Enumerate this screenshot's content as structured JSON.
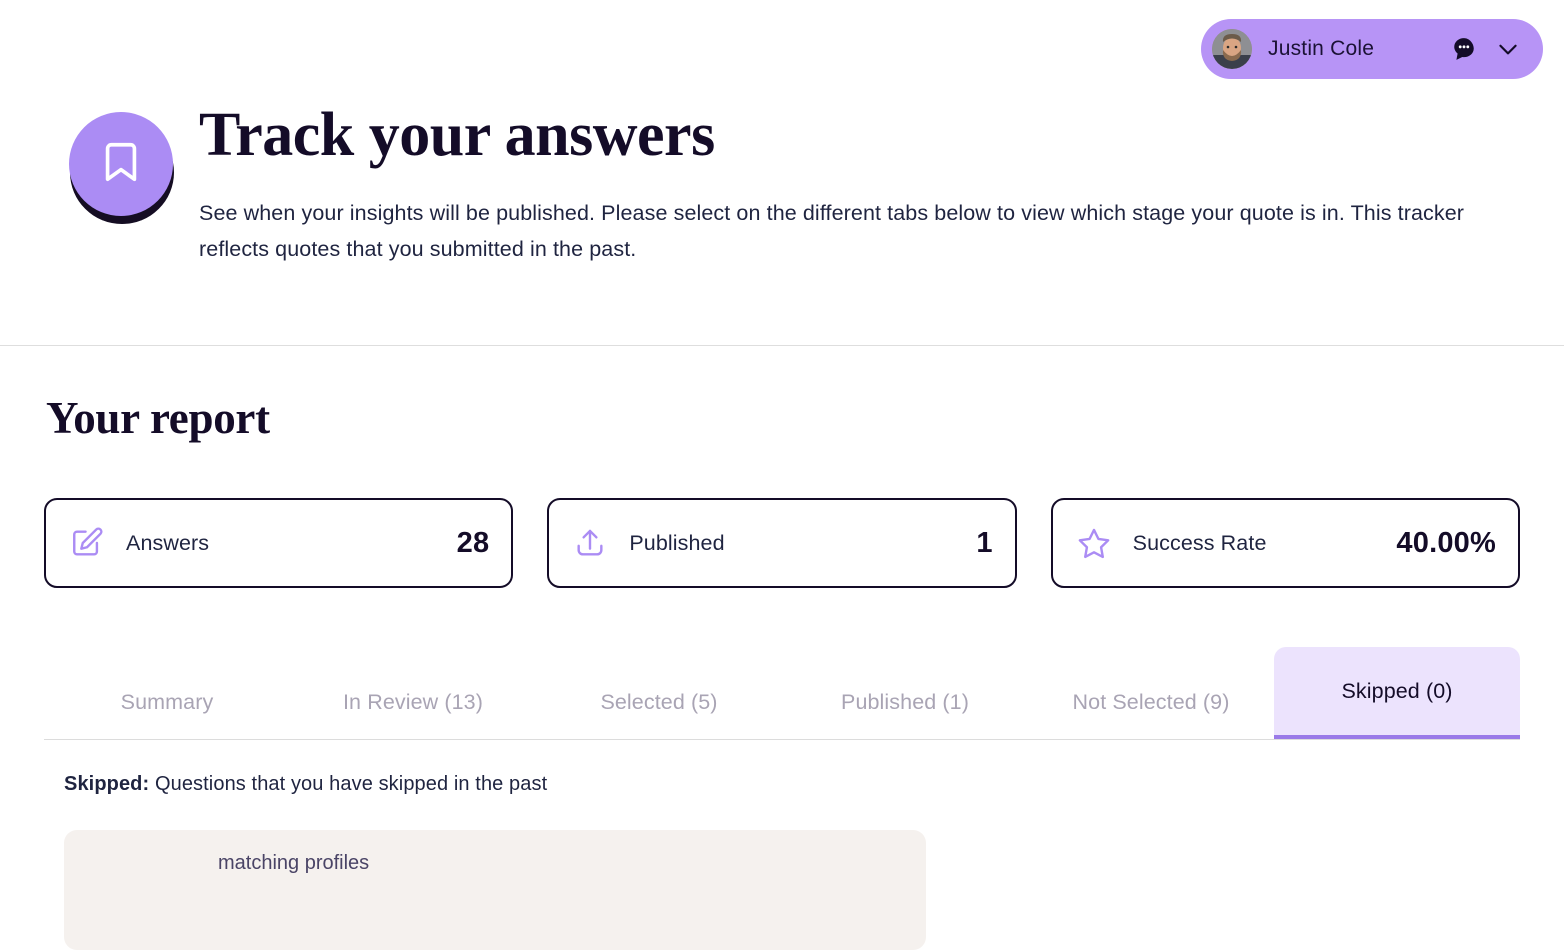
{
  "user": {
    "name": "Justin Cole",
    "avatar_icon": "user-photo-avatar",
    "chat_icon": "chat-bubble-icon",
    "chevron_icon": "chevron-down-icon",
    "pill_color": "#b794f6"
  },
  "header": {
    "icon": "bookmark-icon",
    "icon_bg": "#ab8cf4",
    "title": "Track your answers",
    "description": "See when your insights will be published. Please select on the different tabs below to view which stage your quote is in. This tracker reflects quotes that you submitted in the past."
  },
  "report": {
    "title": "Your report",
    "stats": [
      {
        "icon": "pencil-edit-icon",
        "label": "Answers",
        "value": "28"
      },
      {
        "icon": "upload-share-icon",
        "label": "Published",
        "value": "1"
      },
      {
        "icon": "star-outline-icon",
        "label": "Success Rate",
        "value": "40.00%"
      }
    ]
  },
  "tabs": {
    "items": [
      {
        "label": "Summary",
        "active": false
      },
      {
        "label": "In Review (13)",
        "active": false
      },
      {
        "label": "Selected (5)",
        "active": false
      },
      {
        "label": "Published (1)",
        "active": false
      },
      {
        "label": "Not Selected (9)",
        "active": false
      },
      {
        "label": "Skipped (0)",
        "active": true
      }
    ],
    "active_color": "#ece3fd",
    "active_underline": "#9a7ae8",
    "inactive_color": "#a9a4b4"
  },
  "tab_content": {
    "label": "Skipped:",
    "description": "Questions that you have skipped in the past",
    "panel_text": "matching profiles",
    "panel_bg": "#f5f1ee"
  },
  "theme": {
    "accent_purple": "#ab8cf4",
    "ink": "#140c28",
    "divider": "#dedede"
  }
}
